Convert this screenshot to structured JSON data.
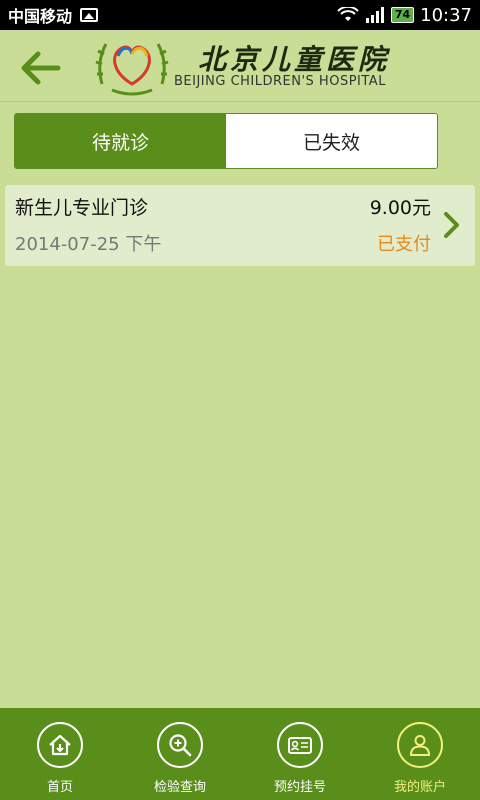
{
  "status_bar": {
    "carrier": "中国移动",
    "battery": "74",
    "time": "10:37"
  },
  "header": {
    "hospital_name_cn": "北京儿童医院",
    "hospital_name_en": "BEIJING CHILDREN'S HOSPITAL"
  },
  "tabs": [
    {
      "label": "待就诊",
      "active": true
    },
    {
      "label": "已失效",
      "active": false
    }
  ],
  "records": [
    {
      "department": "新生儿专业门诊",
      "price": "9.00元",
      "date": "2014-07-25 下午",
      "status": "已支付"
    }
  ],
  "bottom_nav": [
    {
      "label": "首页",
      "icon": "home-icon"
    },
    {
      "label": "检验查询",
      "icon": "search-plus-icon"
    },
    {
      "label": "预约挂号",
      "icon": "id-card-icon"
    },
    {
      "label": "我的账户",
      "icon": "user-icon",
      "current": true
    }
  ],
  "colors": {
    "background": "#c9dd96",
    "primary_green": "#5a8e1b",
    "paid_orange": "#e48b1e",
    "current_nav": "#f2f07a"
  }
}
